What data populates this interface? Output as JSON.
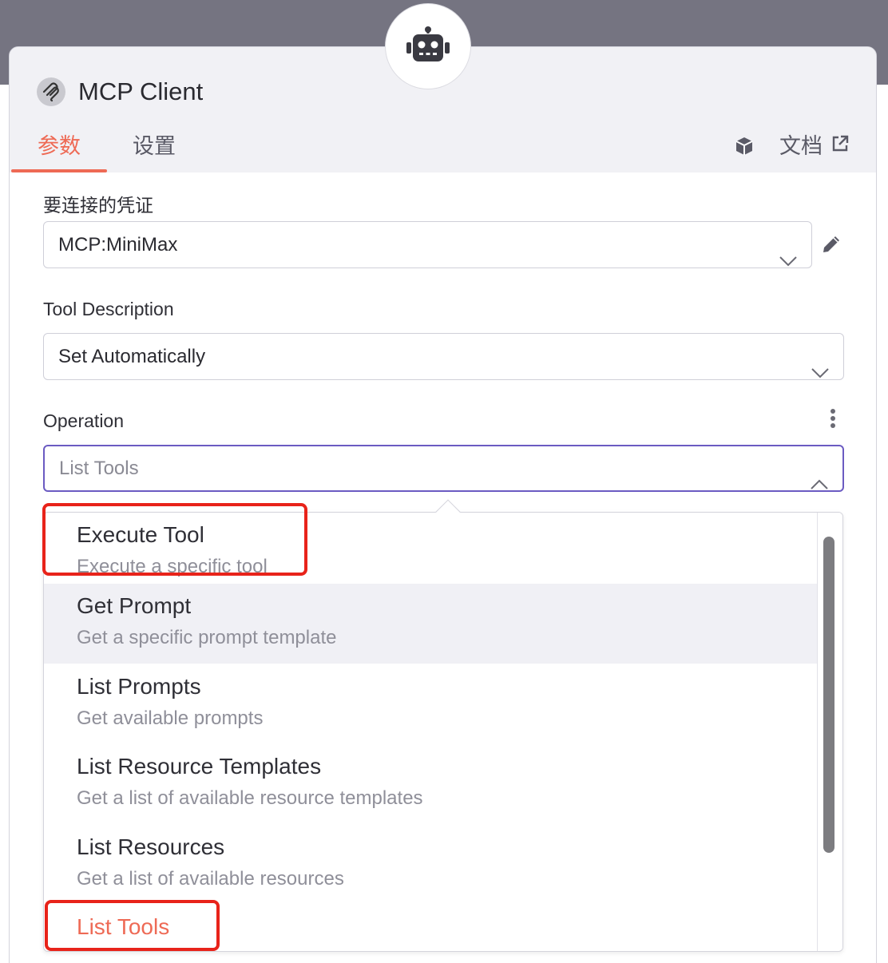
{
  "node": {
    "title": "MCP Client"
  },
  "tabs": {
    "params": "参数",
    "settings": "设置",
    "docs": "文档"
  },
  "credential": {
    "label": "要连接的凭证",
    "value": "MCP:MiniMax"
  },
  "tool_description": {
    "label": "Tool Description",
    "value": "Set Automatically"
  },
  "operation": {
    "label": "Operation",
    "value": "List Tools",
    "options": [
      {
        "name": "Execute Tool",
        "desc": "Execute a specific tool"
      },
      {
        "name": "Get Prompt",
        "desc": "Get a specific prompt template"
      },
      {
        "name": "List Prompts",
        "desc": "Get available prompts"
      },
      {
        "name": "List Resource Templates",
        "desc": "Get a list of available resource templates"
      },
      {
        "name": "List Resources",
        "desc": "Get a list of available resources"
      },
      {
        "name": "List Tools",
        "desc": ""
      }
    ]
  },
  "colors": {
    "accent": "#ee6a55",
    "focus": "#6b5bc2",
    "annotation": "#e8231a"
  }
}
